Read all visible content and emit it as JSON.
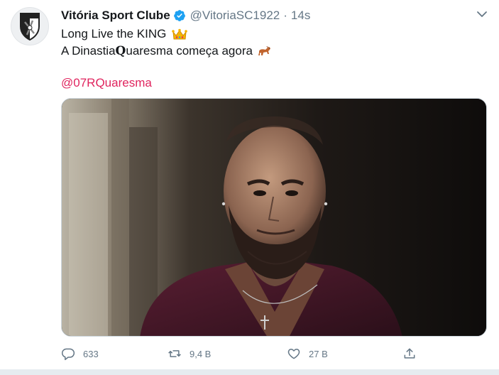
{
  "tweet": {
    "author_name": "Vitória Sport Clube",
    "author_handle": "@VitoriaSC1922",
    "separator": "·",
    "timestamp": "14s",
    "line1_text": "Long Live the KING",
    "line2_prefix": "A Dinastia ",
    "line2_gothic": "Q",
    "line2_suffix": "uaresma começa agora",
    "mention": "@07RQuaresma",
    "media_type": "video",
    "icons": {
      "verified": "verified-badge-icon",
      "crown": "crown-emoji-icon",
      "horse": "horse-emoji-icon",
      "more": "chevron-down-icon"
    }
  },
  "actions": {
    "reply_count": "633",
    "retweet_count": "9,4 B",
    "like_count": "27 B",
    "share_label": ""
  },
  "colors": {
    "accent": "#1da1f2",
    "mention": "#e0245e",
    "secondary_text": "#657786",
    "background": "#ffffff"
  }
}
